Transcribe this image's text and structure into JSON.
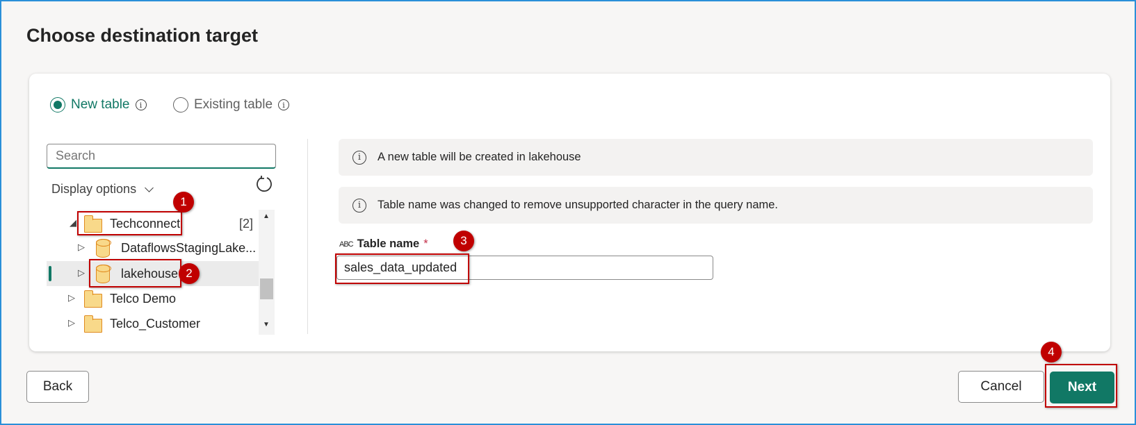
{
  "dialog": {
    "title": "Choose destination target"
  },
  "mode": {
    "new_table": "New table",
    "existing_table": "Existing table",
    "selected": "new_table"
  },
  "navigator": {
    "search_placeholder": "Search",
    "display_options": "Display options",
    "items": [
      {
        "label": "Techconnect",
        "type": "folder",
        "count": "[2]",
        "expanded": true
      },
      {
        "label": "DataflowsStagingLake...",
        "type": "lakehouse"
      },
      {
        "label": "lakehouse",
        "type": "lakehouse",
        "selected": true
      },
      {
        "label": "Telco Demo",
        "type": "folder"
      },
      {
        "label": "Telco_Customer",
        "type": "folder"
      }
    ]
  },
  "messages": [
    "A new table will be created in lakehouse",
    "Table name was changed to remove unsupported character in the query name."
  ],
  "table_name": {
    "label": "Table name",
    "required_mark": "*",
    "value": "sales_data_updated",
    "type_icon": "ABC"
  },
  "footer": {
    "back": "Back",
    "cancel": "Cancel",
    "next": "Next"
  },
  "annotations": [
    "1",
    "2",
    "3",
    "4"
  ],
  "colors": {
    "accent": "#117865",
    "annotation": "#c00000"
  }
}
